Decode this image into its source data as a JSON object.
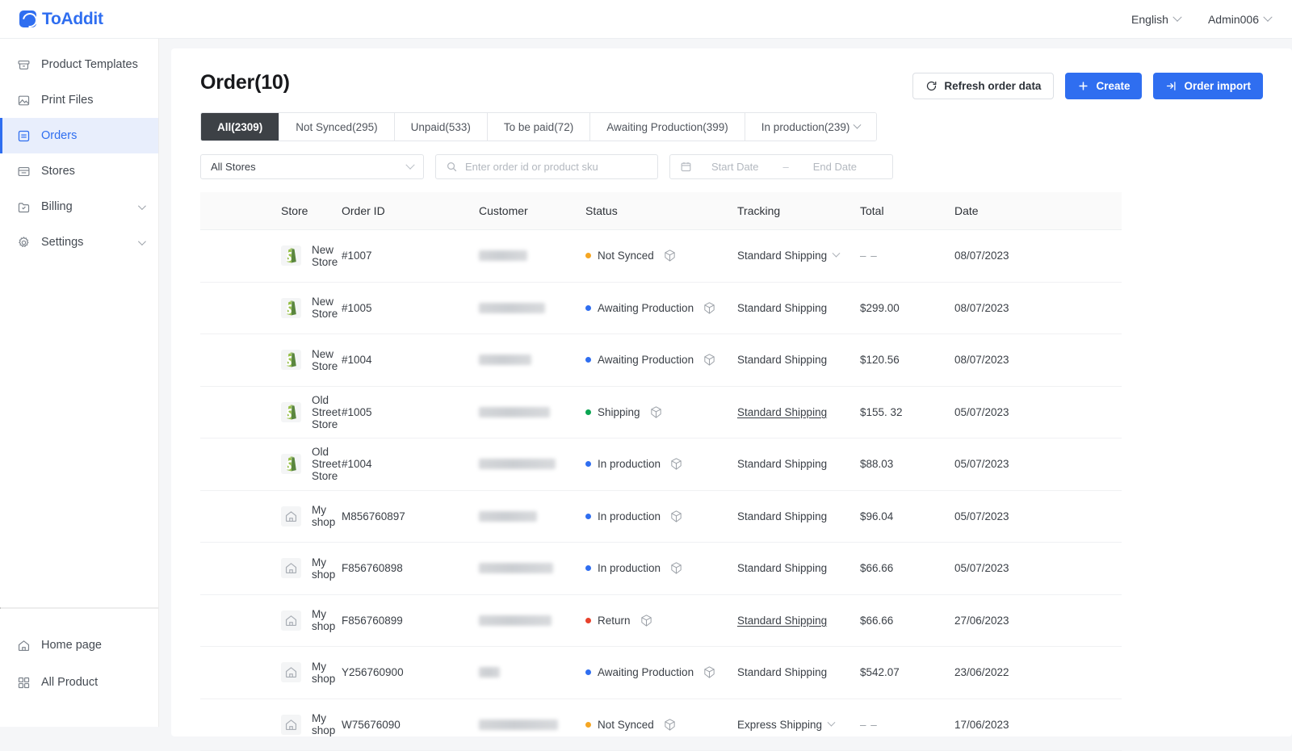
{
  "topbar": {
    "brand": "ToAddit",
    "language": "English",
    "account": "Admin006"
  },
  "sidebar": {
    "items": [
      {
        "label": "Product Templates",
        "icon": "archive-icon",
        "active": false,
        "caret": false
      },
      {
        "label": "Print Files",
        "icon": "image-icon",
        "active": false,
        "caret": false
      },
      {
        "label": "Orders",
        "icon": "orders-icon",
        "active": true,
        "caret": false
      },
      {
        "label": "Stores",
        "icon": "store-icon",
        "active": false,
        "caret": false
      },
      {
        "label": "Billing",
        "icon": "billing-icon",
        "active": false,
        "caret": true
      },
      {
        "label": "Settings",
        "icon": "gear-icon",
        "active": false,
        "caret": true
      }
    ],
    "bottom_items": [
      {
        "label": "Home page",
        "icon": "home-icon"
      },
      {
        "label": "All Product",
        "icon": "grid-icon"
      }
    ]
  },
  "page": {
    "title": "Order(10)",
    "actions": {
      "refresh": "Refresh order data",
      "create": "Create",
      "import": "Order import"
    },
    "tabs": [
      {
        "label": "All(2309)",
        "active": true,
        "caret": false
      },
      {
        "label": "Not Synced(295)",
        "active": false,
        "caret": false
      },
      {
        "label": "Unpaid(533)",
        "active": false,
        "caret": false
      },
      {
        "label": "To be paid(72)",
        "active": false,
        "caret": false
      },
      {
        "label": "Awaiting Production(399)",
        "active": false,
        "caret": false
      },
      {
        "label": "In production(239)",
        "active": false,
        "caret": true
      }
    ],
    "filters": {
      "store_select": "All Stores",
      "search_placeholder": "Enter order id or product sku",
      "start_date": "Start Date",
      "date_separator": "–",
      "end_date": "End Date"
    }
  },
  "table": {
    "columns": [
      "Store",
      "Order ID",
      "Customer",
      "Status",
      "Tracking",
      "Total",
      "Date"
    ],
    "rows": [
      {
        "store": "New Store",
        "store_icon": "shopify-icon",
        "order_id": "#1007",
        "customer_redacted_width": 60,
        "status": "Not Synced",
        "status_color": "#f5a623",
        "tracking": "Standard Shipping",
        "tracking_link": false,
        "tracking_caret": true,
        "total": "– –",
        "total_muted": true,
        "date": "08/07/2023"
      },
      {
        "store": "New Store",
        "store_icon": "shopify-icon",
        "order_id": "#1005",
        "customer_redacted_width": 82,
        "status": "Awaiting Production",
        "status_color": "#2f6ef0",
        "tracking": "Standard Shipping",
        "tracking_link": false,
        "tracking_caret": false,
        "total": "$299.00",
        "total_muted": false,
        "date": "08/07/2023"
      },
      {
        "store": "New Store",
        "store_icon": "shopify-icon",
        "order_id": "#1004",
        "customer_redacted_width": 65,
        "status": "Awaiting Production",
        "status_color": "#2f6ef0",
        "tracking": "Standard Shipping",
        "tracking_link": false,
        "tracking_caret": false,
        "total": "$120.56",
        "total_muted": false,
        "date": "08/07/2023"
      },
      {
        "store": "Old Street Store",
        "store_icon": "shopify-icon",
        "order_id": "#1005",
        "customer_redacted_width": 88,
        "status": "Shipping",
        "status_color": "#0ba552",
        "tracking": "Standard Shipping",
        "tracking_link": true,
        "tracking_caret": false,
        "total": "$155. 32",
        "total_muted": false,
        "date": "05/07/2023"
      },
      {
        "store": "Old Street Store",
        "store_icon": "shopify-icon",
        "order_id": "#1004",
        "customer_redacted_width": 95,
        "status": "In production",
        "status_color": "#2f6ef0",
        "tracking": "Standard Shipping",
        "tracking_link": false,
        "tracking_caret": false,
        "total": "$88.03",
        "total_muted": false,
        "date": "05/07/2023"
      },
      {
        "store": "My shop",
        "store_icon": "home-icon",
        "order_id": "M856760897",
        "customer_redacted_width": 72,
        "status": "In production",
        "status_color": "#2f6ef0",
        "tracking": "Standard Shipping",
        "tracking_link": false,
        "tracking_caret": false,
        "total": "$96.04",
        "total_muted": false,
        "date": "05/07/2023"
      },
      {
        "store": "My shop",
        "store_icon": "home-icon",
        "order_id": "F856760898",
        "customer_redacted_width": 92,
        "status": "In production",
        "status_color": "#2f6ef0",
        "tracking": "Standard Shipping",
        "tracking_link": false,
        "tracking_caret": false,
        "total": "$66.66",
        "total_muted": false,
        "date": "05/07/2023"
      },
      {
        "store": "My shop",
        "store_icon": "home-icon",
        "order_id": "F856760899",
        "customer_redacted_width": 90,
        "status": "Return",
        "status_color": "#e8412c",
        "tracking": "Standard Shipping",
        "tracking_link": true,
        "tracking_caret": false,
        "total": "$66.66",
        "total_muted": false,
        "date": "27/06/2023"
      },
      {
        "store": "My shop",
        "store_icon": "home-icon",
        "order_id": "Y256760900",
        "customer_redacted_width": 26,
        "status": "Awaiting Production",
        "status_color": "#2f6ef0",
        "tracking": "Standard Shipping",
        "tracking_link": false,
        "tracking_caret": false,
        "total": "$542.07",
        "total_muted": false,
        "date": "23/06/2022"
      },
      {
        "store": "My shop",
        "store_icon": "home-icon",
        "order_id": "W75676090",
        "customer_redacted_width": 98,
        "status": "Not Synced",
        "status_color": "#f5a623",
        "tracking": "Express Shipping",
        "tracking_link": false,
        "tracking_caret": true,
        "total": "– –",
        "total_muted": true,
        "date": "17/06/2023"
      }
    ]
  },
  "colors": {
    "brand": "#2f6ef0",
    "tab_active_bg": "#3d4146",
    "status_orange": "#f5a623",
    "status_blue": "#2f6ef0",
    "status_green": "#0ba552",
    "status_red": "#e8412c"
  }
}
